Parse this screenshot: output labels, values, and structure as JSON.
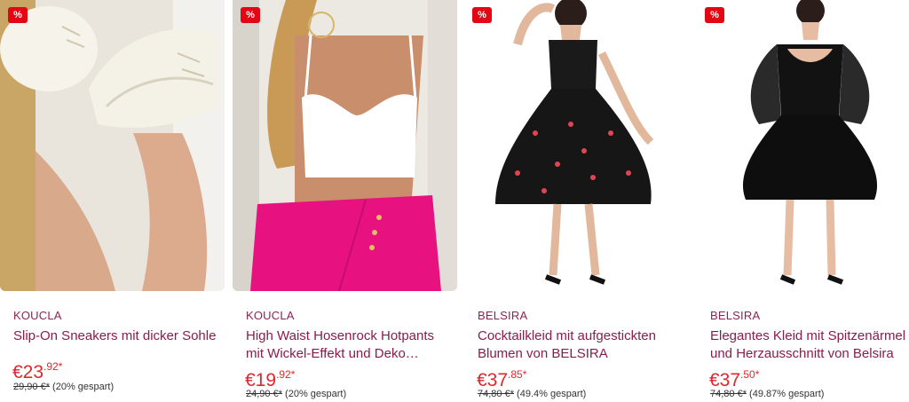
{
  "products": [
    {
      "badge": "%",
      "brand": "KOUCLA",
      "title": "Slip-On Sneakers mit dicker Sohle",
      "price_main": "€23",
      "price_cents": ".92*",
      "old_price": "29,90 €*",
      "savings": "(20% gespart)"
    },
    {
      "badge": "%",
      "brand": "KOUCLA",
      "title": "High Waist Hosenrock Hotpants mit Wickel-Effekt und Deko…",
      "price_main": "€19",
      "price_cents": ".92*",
      "old_price": "24,90 €*",
      "savings": "(20% gespart)"
    },
    {
      "badge": "%",
      "brand": "BELSIRA",
      "title": "Cocktailkleid mit aufgestickten Blumen von BELSIRA",
      "price_main": "€37",
      "price_cents": ".85*",
      "old_price": "74,80 €*",
      "savings": "(49.4% gespart)"
    },
    {
      "badge": "%",
      "brand": "BELSIRA",
      "title": "Elegantes Kleid mit Spitzenärmel und Herzausschnitt von Belsira",
      "price_main": "€37",
      "price_cents": ".50*",
      "old_price": "74,80 €*",
      "savings": "(49.87% gespart)"
    }
  ],
  "colors": {
    "brand_text": "#8a2454",
    "title_text": "#8a1c4b",
    "price": "#e1262c",
    "badge": "#e30613"
  }
}
